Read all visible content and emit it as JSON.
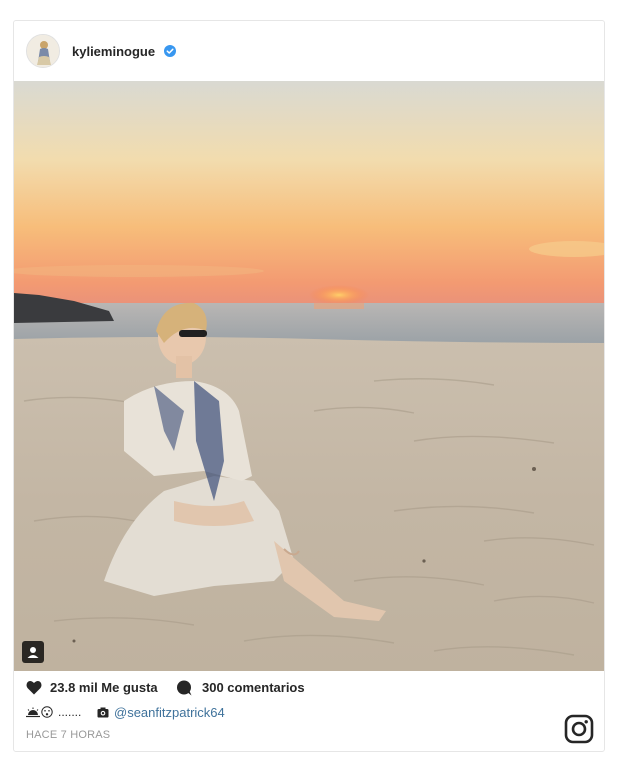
{
  "post": {
    "username": "kylieminogue",
    "verified": true,
    "likes_text": "23.8 mil Me gusta",
    "comments_text": "300 comentarios",
    "caption_dots": ".......",
    "caption_mention": "@seanfitzpatrick64",
    "timestamp": "HACE 7 HORAS"
  },
  "colors": {
    "verified_badge": "#3897f0",
    "mention_link": "#3f729b",
    "timestamp": "#999999",
    "text": "#262626"
  },
  "icons": {
    "avatar": "avatar",
    "verified": "verified-badge-icon",
    "tag": "user-tag-icon",
    "like": "heart-icon",
    "comment": "comment-bubble-icon",
    "caption_emoji_1": "sunset-emoji-icon",
    "caption_emoji_2": "face-emoji-icon",
    "caption_camera": "camera-icon",
    "brand": "instagram-icon"
  }
}
